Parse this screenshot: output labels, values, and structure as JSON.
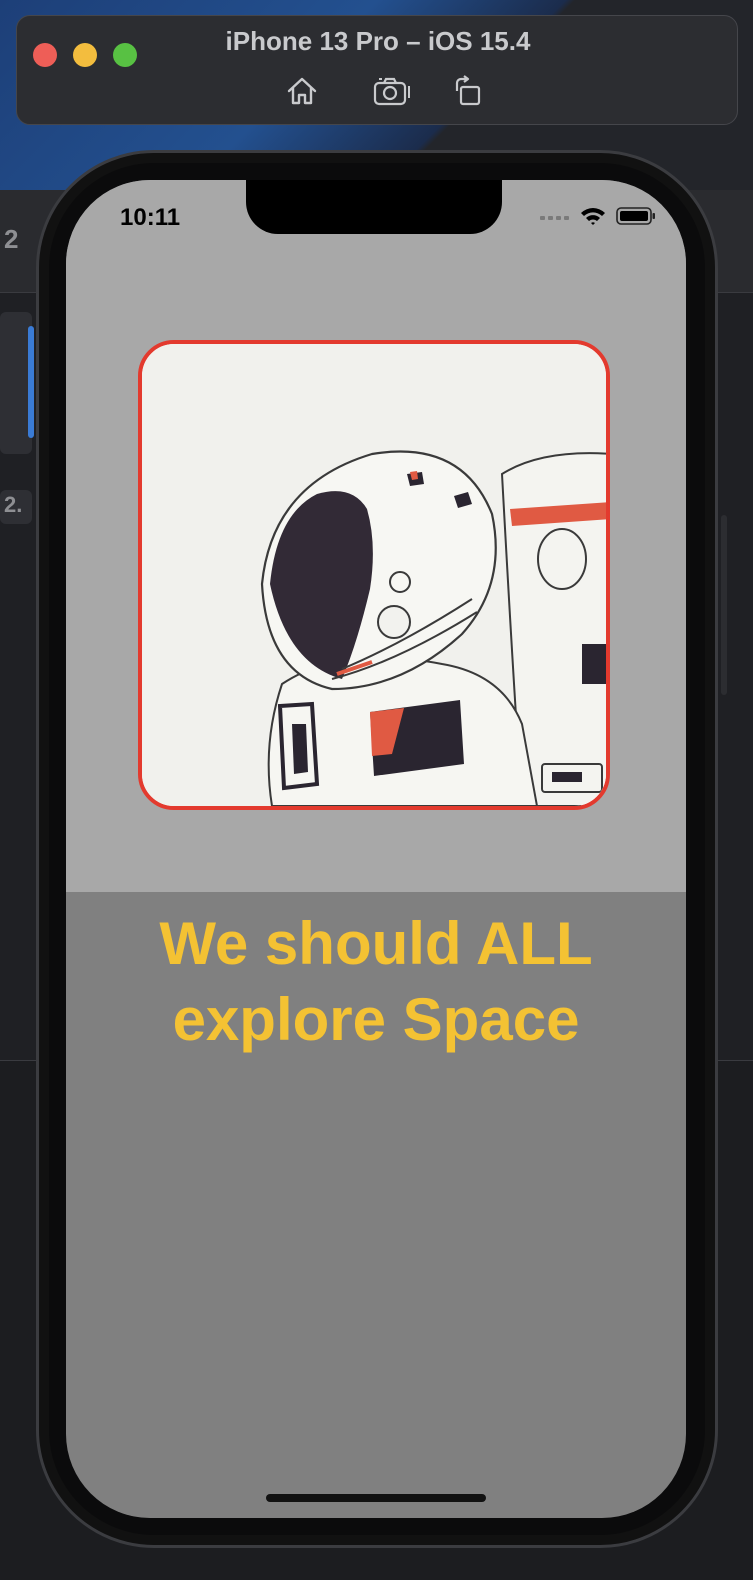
{
  "simulator": {
    "title": "iPhone 13 Pro – iOS 15.4",
    "toolbar": [
      {
        "icon": "home-icon"
      },
      {
        "icon": "screenshot-icon"
      },
      {
        "icon": "rotate-icon"
      }
    ]
  },
  "background": {
    "side_numbers": [
      "2",
      "2."
    ]
  },
  "status_bar": {
    "time": "10:11",
    "icons": [
      "signal-icon",
      "wifi-icon",
      "battery-icon"
    ]
  },
  "app": {
    "image_alt": "astronaut illustration",
    "headline_line1": "We should ALL",
    "headline_line2": "explore Space",
    "colors": {
      "top_background": "#a8a8a8",
      "bottom_background": "#808080",
      "headline": "#f4c233",
      "image_border": "#e33a2e"
    }
  }
}
